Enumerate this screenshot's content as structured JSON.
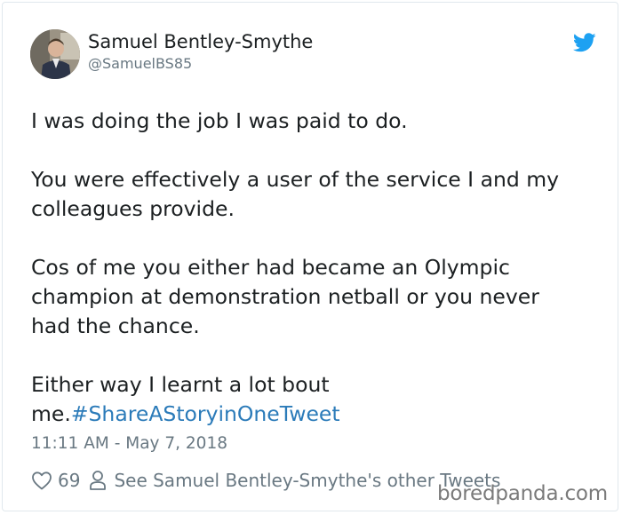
{
  "author": {
    "name": "Samuel Bentley-Smythe",
    "handle": "@SamuelBS85"
  },
  "tweet": {
    "line1": "I was doing the job I was paid to do.",
    "para2_line1": "You were effectively a user of the service I and my",
    "para2_line2": "colleagues provide.",
    "para3_line1": "Cos of me you either had became an Olympic",
    "para3_line2": "champion at demonstration netball or you never",
    "para3_line3": "had the chance.",
    "para4_line1": "Either way I learnt a lot bout",
    "para4_line2_text": "me.",
    "hashtag": "#ShareAStoryinOneTweet"
  },
  "timestamp": "11:11 AM - May 7, 2018",
  "actions": {
    "like_count": "69",
    "profile_link": "See Samuel Bentley-Smythe's other Tweets"
  },
  "icons": {
    "bird": "twitter-bird-icon",
    "heart": "heart-icon",
    "person": "person-icon"
  },
  "colors": {
    "twitter_blue": "#1da1f2",
    "link_blue": "#2b7bb9",
    "meta_gray": "#697882",
    "text": "#1c2022"
  },
  "watermark": "boredpanda.com"
}
